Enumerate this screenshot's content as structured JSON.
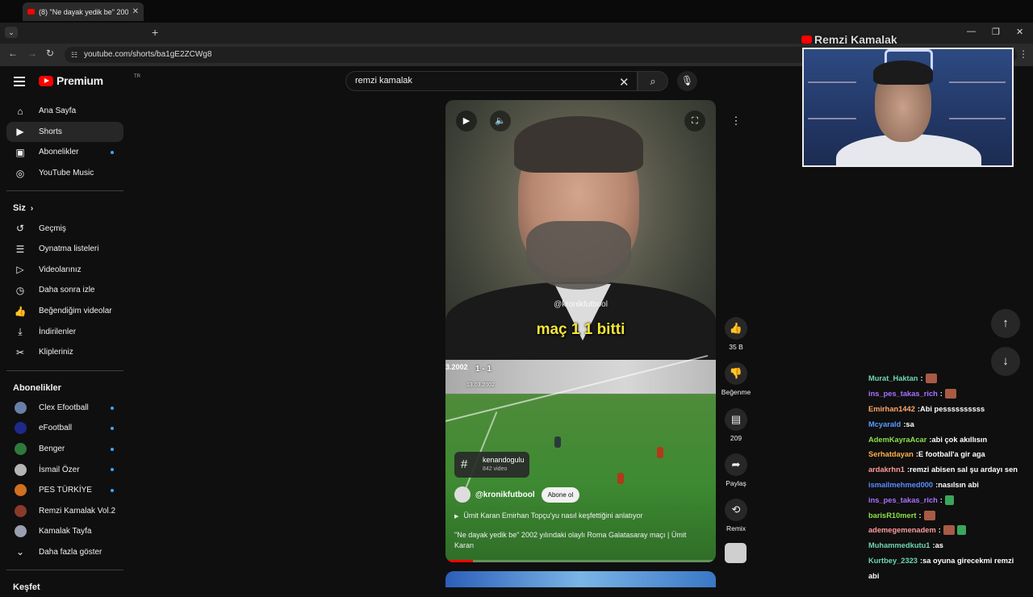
{
  "browser": {
    "tab_title": "(8) \"Ne dayak yedik be\" 2002 y",
    "url": "youtube.com/shorts/ba1gE2ZCWg8",
    "new_tab": "+",
    "minimize": "—",
    "restore": "❐",
    "close": "✕"
  },
  "youtube": {
    "logo_text": "Premium",
    "logo_region": "TR",
    "search_value": "remzi kamalak"
  },
  "sidebar": {
    "main": [
      {
        "label": "Ana Sayfa",
        "icon": "home-icon"
      },
      {
        "label": "Shorts",
        "icon": "shorts-icon"
      },
      {
        "label": "Abonelikler",
        "icon": "subscriptions-icon"
      },
      {
        "label": "YouTube Music",
        "icon": "music-icon"
      }
    ],
    "you_header": "Siz",
    "you": [
      {
        "label": "Geçmiş",
        "icon": "history-icon"
      },
      {
        "label": "Oynatma listeleri",
        "icon": "playlists-icon"
      },
      {
        "label": "Videolarınız",
        "icon": "your-videos-icon"
      },
      {
        "label": "Daha sonra izle",
        "icon": "watch-later-icon"
      },
      {
        "label": "Beğendiğim videolar",
        "icon": "liked-icon"
      },
      {
        "label": "İndirilenler",
        "icon": "download-icon"
      },
      {
        "label": "Klipleriniz",
        "icon": "clips-icon"
      }
    ],
    "subs_header": "Abonelikler",
    "subs": [
      {
        "label": "Clex Efootball",
        "color": "#6a7fa8"
      },
      {
        "label": "eFootball",
        "color": "#1d2a8c"
      },
      {
        "label": "Benger",
        "color": "#2e7a3a"
      },
      {
        "label": "İsmail Özer",
        "color": "#b5b5b5"
      },
      {
        "label": "PES TÜRKİYE",
        "color": "#d07020"
      },
      {
        "label": "Remzi Kamalak Vol.2",
        "color": "#8a3a2a"
      },
      {
        "label": "Kamalak Tayfa",
        "color": "#9aa0b0"
      }
    ],
    "show_more": "Daha fazla göster",
    "explore_header": "Keşfet"
  },
  "short": {
    "watermark": "@kronikfutbool",
    "caption": "maç 1 1 bitti",
    "year_tag": "3.2002",
    "score": "1 - 1",
    "match_date": "13.03.2002",
    "hashtag": "kenandogulu",
    "hashtag_count": "842 video",
    "channel": "@kronikfutbool",
    "subscribe": "Abone ol",
    "desc_line": "Ümit Karan Emirhan Topçu'yu nasıl keşfettiğini anlatıyor",
    "title": "\"Ne dayak yedik be\" 2002 yılındaki olaylı Roma Galatasaray maçı | Ümit Karan",
    "progress": 0.1
  },
  "actions": {
    "likes": "35 B",
    "dislike": "Beğenme",
    "comments": "209",
    "share": "Paylaş",
    "remix": "Remix"
  },
  "overlay": {
    "streamer": "Remzi Kamalak"
  },
  "chat": [
    {
      "user": "Murat_Haktan",
      "color": "#6fd6b0",
      "msg": "",
      "emote": "brown"
    },
    {
      "user": "ins_pes_takas_rich",
      "color": "#a870ff",
      "msg": "",
      "emote": "brown"
    },
    {
      "user": "Emirhan1442",
      "color": "#ffa86a",
      "msg": "Abi pessssssssss",
      "emote": ""
    },
    {
      "user": "Mcyarald",
      "color": "#5a9bff",
      "msg": "sa",
      "emote": ""
    },
    {
      "user": "AdemKayraAcar",
      "color": "#8be04a",
      "msg": "abi çok akıllısın",
      "emote": ""
    },
    {
      "user": "Serhatdayan",
      "color": "#ffb04a",
      "msg": "E football'a gir aga",
      "emote": ""
    },
    {
      "user": "ardakrhn1",
      "color": "#ff9a9a",
      "msg": "remzi abisen sal şu ardayı sen",
      "emote": ""
    },
    {
      "user": "ismailmehmed000",
      "color": "#5a8cff",
      "msg": "nasılsın abi",
      "emote": ""
    },
    {
      "user": "ins_pes_takas_rich",
      "color": "#a870ff",
      "msg": "",
      "emote": "green"
    },
    {
      "user": "barisR10mert",
      "color": "#8be04a",
      "msg": "",
      "emote": "brown"
    },
    {
      "user": "ademegemenadem",
      "color": "#ff9a9a",
      "msg": "",
      "emote": "both"
    },
    {
      "user": "Muhammedkutu1",
      "color": "#6fd6b0",
      "msg": "as",
      "emote": ""
    },
    {
      "user": "Kurtbey_2323",
      "color": "#6fd6b0",
      "msg": "sa oyuna girecekmi remzi",
      "emote": ""
    },
    {
      "user": "",
      "color": "#ffffff",
      "msg": "abi",
      "emote": ""
    }
  ]
}
